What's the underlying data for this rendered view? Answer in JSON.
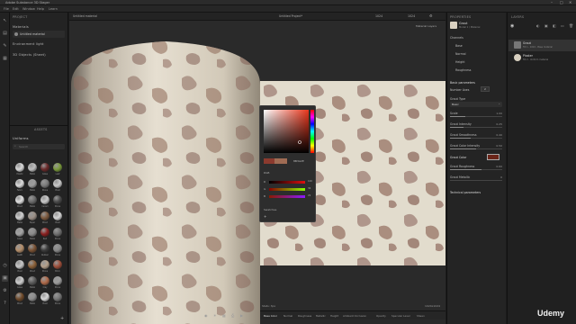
{
  "window": {
    "title": "Adobe Substance 3D Stager"
  },
  "menubar": [
    "File",
    "Edit",
    "Window",
    "Help",
    "Learn"
  ],
  "viewport": {
    "tab_label": "Untitled material",
    "center_title": "Untitled Project*",
    "render_mode": "Material Layers",
    "zoom_left": "1024",
    "zoom_right": "1024",
    "status_left": "Stats: 3px",
    "status_right": "1024x1024"
  },
  "scene": {
    "header": "PROJECT",
    "section_materials": "Materials",
    "material_item": "Untitled material",
    "environment_light": "Environment light",
    "objects": "3D Objects (Sheet)"
  },
  "assets": {
    "header": "ASSETS",
    "category": "Uniforms",
    "search_placeholder": "Search",
    "swatch_labels": [
      "Plastic",
      "Metal",
      "Glass",
      "Leaf",
      "Fabric",
      "Metal",
      "Stone",
      "Plast",
      "Wood",
      "Metal",
      "Ceram",
      "Stone",
      "Metal",
      "Paper",
      "Wood",
      "Plast",
      "Glass",
      "Metal",
      "Red",
      "Stone",
      "Leath",
      "Wood",
      "Rubber",
      "Stone",
      "Plast",
      "Wood",
      "Stone",
      "Brick",
      "Glass",
      "Metal",
      "Clay",
      "Stone",
      "Wood",
      "Metal",
      "Plast",
      "Stone"
    ],
    "swatch_colors": [
      "#d8d8d8",
      "#bdbdbd",
      "#6b2a2a",
      "#7a9a3b",
      "#dddddd",
      "#9d9d9d",
      "#7b7b7b",
      "#cbcbcb",
      "#e2e2e2",
      "#6b6b6b",
      "#c9c9c9",
      "#4b4b4b",
      "#d0d0d0",
      "#9a8f86",
      "#7d5a3f",
      "#d6d6d6",
      "#a4a4a4",
      "#8a8a8a",
      "#8a2020",
      "#6e6e6e",
      "#b48e6a",
      "#7a5234",
      "#3b3b3b",
      "#888888",
      "#c7c7c7",
      "#8b6038",
      "#b5a08a",
      "#9e4e3a",
      "#cfcfcf",
      "#5c5c5c",
      "#b06a4a",
      "#9d9d9d",
      "#6f4a2a",
      "#8c8c8c",
      "#d9d9d9",
      "#757575"
    ]
  },
  "picker": {
    "hex_value": "#8B3A2E",
    "old_swatch": "#8b3a2e",
    "new_swatch": "#a06c54",
    "swatches_label": "Swatches",
    "mode_label": "RGB",
    "r_label": "R",
    "g_label": "G",
    "b_label": "B",
    "r_value": "100",
    "g_value": "36",
    "b_value": "29",
    "hex_field": "8B3A2E"
  },
  "properties": {
    "header": "PROPERTIES",
    "material_name": "Grout",
    "material_sub": "Model 1 / Material",
    "section_channels": "Channels",
    "channels": [
      "Base",
      "Normal",
      "Height",
      "Roughness"
    ],
    "section_basic": "Basic parameters",
    "params": [
      {
        "label": "Number Axes",
        "value": "2"
      },
      {
        "label": "Grout Type",
        "value": "Basic"
      },
      {
        "label": "Scale",
        "value": "1.00"
      },
      {
        "label": "Grout Intensity",
        "value": "0.25"
      },
      {
        "label": "Grout Smoothness",
        "value": "0.40"
      },
      {
        "label": "Grout Color Intensity",
        "value": "0.50"
      }
    ],
    "grout_color_label": "Grout Color",
    "grout_color": "#6a2418",
    "more_params": [
      {
        "label": "Grout Roughness",
        "value": "0.60"
      },
      {
        "label": "Grout Metallic",
        "value": "0"
      }
    ],
    "section_tech": "Technical parameters"
  },
  "layers": {
    "header": "LAYERS",
    "items": [
      {
        "name": "Grout",
        "sub": "Fill 1 - 1024 - Base material"
      },
      {
        "name": "Plaster",
        "sub": "Fill 2 - Uniform material"
      }
    ]
  },
  "bottombar": {
    "channels": [
      "Base Color",
      "Normal",
      "Roughness",
      "Metallic",
      "Height",
      "Ambient Occlusion",
      "Opacity",
      "Specular Level",
      "Sheen"
    ]
  },
  "watermark": "Udemy"
}
